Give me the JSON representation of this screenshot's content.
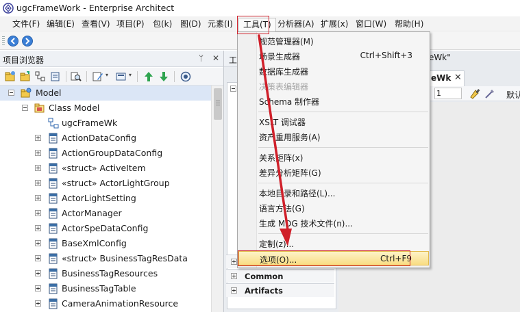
{
  "window": {
    "title": "ugcFrameWork - Enterprise Architect"
  },
  "menubar": {
    "items": [
      "文件(F)",
      "编辑(E)",
      "查看(V)",
      "项目(P)",
      "包(k)",
      "图(D)",
      "元素(I)",
      "工具(T)",
      "分析器(A)",
      "扩展(x)",
      "窗口(W)",
      "帮助(H)"
    ]
  },
  "project_browser": {
    "title": "项目浏览器",
    "pin_glyph": "ᛘ",
    "close_glyph": "✕",
    "tree": [
      {
        "label": "Model",
        "icon": "model-root-icon",
        "expander": "minus"
      },
      {
        "label": "Class Model",
        "icon": "package-icon",
        "expander": "minus"
      },
      {
        "label": "ugcFrameWk",
        "icon": "class-diagram-icon",
        "expander": "none"
      },
      {
        "label": "ActionDataConfig",
        "icon": "class-icon",
        "expander": "plus"
      },
      {
        "label": "ActionGroupDataConfig",
        "icon": "class-icon",
        "expander": "plus"
      },
      {
        "label": "«struct» ActiveItem",
        "icon": "class-icon",
        "expander": "plus"
      },
      {
        "label": "«struct» ActorLightGroup",
        "icon": "class-icon",
        "expander": "plus"
      },
      {
        "label": "ActorLightSetting",
        "icon": "class-icon",
        "expander": "plus"
      },
      {
        "label": "ActorManager",
        "icon": "class-icon",
        "expander": "plus"
      },
      {
        "label": "ActorSpeDataConfig",
        "icon": "class-icon",
        "expander": "plus"
      },
      {
        "label": "BaseXmlConfig",
        "icon": "class-icon",
        "expander": "plus"
      },
      {
        "label": "«struct» BusinessTagResData",
        "icon": "class-icon",
        "expander": "plus"
      },
      {
        "label": "BusinessTagResources",
        "icon": "class-icon",
        "expander": "plus"
      },
      {
        "label": "BusinessTagTable",
        "icon": "class-icon",
        "expander": "plus"
      },
      {
        "label": "CameraAnimationResource",
        "icon": "class-icon",
        "expander": "plus"
      }
    ]
  },
  "toolbox": {
    "header": "工",
    "sections": [
      "Common",
      "Artifacts"
    ]
  },
  "document": {
    "caption": "eWk\"",
    "tab_label": "eWk",
    "tab_close": "✕",
    "toolbar_value": "1",
    "default_text": "默认"
  },
  "tools_menu": {
    "items": [
      {
        "label": "规范管理器(M)",
        "shortcut": "",
        "disabled": false
      },
      {
        "label": "场景生成器",
        "shortcut": "Ctrl+Shift+3",
        "disabled": false
      },
      {
        "label": "数据库生成器",
        "shortcut": "",
        "disabled": false
      },
      {
        "label": "决策表编辑器",
        "shortcut": "",
        "disabled": true
      },
      {
        "label": "Schema 制作器",
        "shortcut": "",
        "disabled": false,
        "separator_after": true
      },
      {
        "label": "XSLT 调试器",
        "shortcut": "",
        "disabled": false
      },
      {
        "label": "资产重用服务(A)",
        "shortcut": "",
        "disabled": false,
        "separator_after": true
      },
      {
        "label": "关系矩阵(x)",
        "shortcut": "",
        "disabled": false
      },
      {
        "label": "差异分析矩阵(G)",
        "shortcut": "",
        "disabled": false,
        "separator_after": true
      },
      {
        "label": "本地目录和路径(L)...",
        "shortcut": "",
        "disabled": false
      },
      {
        "label": "语言方法(G)",
        "shortcut": "",
        "disabled": false
      },
      {
        "label": "生成 MDG 技术文件(n)...",
        "shortcut": "",
        "disabled": false,
        "separator_after": true
      },
      {
        "label": "定制(z)...",
        "shortcut": "",
        "disabled": false
      },
      {
        "label": "选项(O)...",
        "shortcut": "Ctrl+F9",
        "disabled": false,
        "highlighted": true
      }
    ]
  },
  "colors": {
    "annotation_red": "#d0202a",
    "highlight_gold": "#f9dd83",
    "accent_blue": "#3b7fd6"
  }
}
